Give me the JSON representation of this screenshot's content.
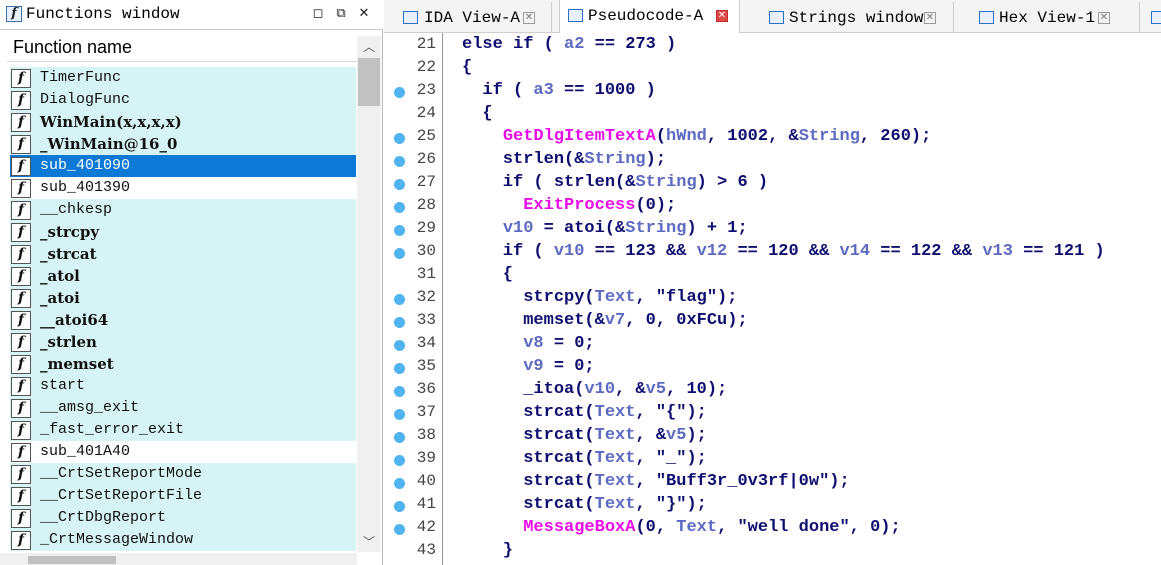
{
  "functions_window": {
    "title": "Functions window",
    "column_header": "Function name",
    "items": [
      {
        "name": "TimerFunc",
        "style": "normal",
        "bg": "cyan"
      },
      {
        "name": "DialogFunc",
        "style": "normal",
        "bg": "cyan"
      },
      {
        "name": "WinMain(x,x,x,x)",
        "style": "bold",
        "bg": "cyan"
      },
      {
        "name": "_WinMain@16_0",
        "style": "bold",
        "bg": "cyan"
      },
      {
        "name": "sub_401090",
        "style": "normal",
        "bg": "selected"
      },
      {
        "name": "sub_401390",
        "style": "normal",
        "bg": "white"
      },
      {
        "name": "__chkesp",
        "style": "normal",
        "bg": "cyan"
      },
      {
        "name": "_strcpy",
        "style": "bold",
        "bg": "cyan"
      },
      {
        "name": "_strcat",
        "style": "bold",
        "bg": "cyan"
      },
      {
        "name": "_atol",
        "style": "bold",
        "bg": "cyan"
      },
      {
        "name": "_atoi",
        "style": "bold",
        "bg": "cyan"
      },
      {
        "name": "__atoi64",
        "style": "bold",
        "bg": "cyan"
      },
      {
        "name": "_strlen",
        "style": "bold",
        "bg": "cyan"
      },
      {
        "name": "_memset",
        "style": "bold",
        "bg": "cyan"
      },
      {
        "name": "start",
        "style": "normal",
        "bg": "cyan"
      },
      {
        "name": "__amsg_exit",
        "style": "normal",
        "bg": "cyan"
      },
      {
        "name": "_fast_error_exit",
        "style": "normal",
        "bg": "cyan"
      },
      {
        "name": "sub_401A40",
        "style": "normal",
        "bg": "white"
      },
      {
        "name": "__CrtSetReportMode",
        "style": "normal",
        "bg": "cyan"
      },
      {
        "name": "__CrtSetReportFile",
        "style": "normal",
        "bg": "cyan"
      },
      {
        "name": "__CrtDbgReport",
        "style": "normal",
        "bg": "cyan"
      },
      {
        "name": "_CrtMessageWindow",
        "style": "normal",
        "bg": "cyan"
      }
    ]
  },
  "tabs": [
    {
      "label": "IDA View-A",
      "active": false
    },
    {
      "label": "Pseudocode-A",
      "active": true
    },
    {
      "label": "Strings window",
      "active": false
    },
    {
      "label": "Hex View-1",
      "active": false
    }
  ],
  "code_lines": [
    {
      "num": "21",
      "dot": false,
      "tokens": [
        [
          "t",
          "else if ( "
        ],
        [
          "v",
          "a2"
        ],
        [
          "t",
          " == 273 )"
        ]
      ]
    },
    {
      "num": "22",
      "dot": false,
      "tokens": [
        [
          "t",
          "{"
        ]
      ]
    },
    {
      "num": "23",
      "dot": true,
      "tokens": [
        [
          "t",
          "  if ( "
        ],
        [
          "v",
          "a3"
        ],
        [
          "t",
          " == 1000 )"
        ]
      ]
    },
    {
      "num": "24",
      "dot": false,
      "tokens": [
        [
          "t",
          "  {"
        ]
      ]
    },
    {
      "num": "25",
      "dot": true,
      "tokens": [
        [
          "t",
          "    "
        ],
        [
          "f",
          "GetDlgItemTextA"
        ],
        [
          "t",
          "("
        ],
        [
          "v",
          "hWnd"
        ],
        [
          "t",
          ", 1002, &"
        ],
        [
          "v",
          "String"
        ],
        [
          "t",
          ", 260);"
        ]
      ]
    },
    {
      "num": "26",
      "dot": true,
      "tokens": [
        [
          "t",
          "    strlen(&"
        ],
        [
          "v",
          "String"
        ],
        [
          "t",
          ");"
        ]
      ]
    },
    {
      "num": "27",
      "dot": true,
      "tokens": [
        [
          "t",
          "    if ( strlen(&"
        ],
        [
          "v",
          "String"
        ],
        [
          "t",
          ") > 6 )"
        ]
      ]
    },
    {
      "num": "28",
      "dot": true,
      "tokens": [
        [
          "t",
          "      "
        ],
        [
          "f",
          "ExitProcess"
        ],
        [
          "t",
          "(0);"
        ]
      ]
    },
    {
      "num": "29",
      "dot": true,
      "tokens": [
        [
          "t",
          "    "
        ],
        [
          "v",
          "v10"
        ],
        [
          "t",
          " = atoi(&"
        ],
        [
          "v",
          "String"
        ],
        [
          "t",
          ") + 1;"
        ]
      ]
    },
    {
      "num": "30",
      "dot": true,
      "tokens": [
        [
          "t",
          "    if ( "
        ],
        [
          "v",
          "v10"
        ],
        [
          "t",
          " == 123 && "
        ],
        [
          "v",
          "v12"
        ],
        [
          "t",
          " == 120 && "
        ],
        [
          "v",
          "v14"
        ],
        [
          "t",
          " == 122 && "
        ],
        [
          "v",
          "v13"
        ],
        [
          "t",
          " == 121 )"
        ]
      ]
    },
    {
      "num": "31",
      "dot": false,
      "tokens": [
        [
          "t",
          "    {"
        ]
      ]
    },
    {
      "num": "32",
      "dot": true,
      "tokens": [
        [
          "t",
          "      strcpy("
        ],
        [
          "v",
          "Text"
        ],
        [
          "t",
          ", \"flag\");"
        ]
      ]
    },
    {
      "num": "33",
      "dot": true,
      "tokens": [
        [
          "t",
          "      memset(&"
        ],
        [
          "v",
          "v7"
        ],
        [
          "t",
          ", 0, 0xFCu);"
        ]
      ]
    },
    {
      "num": "34",
      "dot": true,
      "tokens": [
        [
          "t",
          "      "
        ],
        [
          "v",
          "v8"
        ],
        [
          "t",
          " = 0;"
        ]
      ]
    },
    {
      "num": "35",
      "dot": true,
      "tokens": [
        [
          "t",
          "      "
        ],
        [
          "v",
          "v9"
        ],
        [
          "t",
          " = 0;"
        ]
      ]
    },
    {
      "num": "36",
      "dot": true,
      "tokens": [
        [
          "t",
          "      _itoa("
        ],
        [
          "v",
          "v10"
        ],
        [
          "t",
          ", &"
        ],
        [
          "v",
          "v5"
        ],
        [
          "t",
          ", 10);"
        ]
      ]
    },
    {
      "num": "37",
      "dot": true,
      "tokens": [
        [
          "t",
          "      strcat("
        ],
        [
          "v",
          "Text"
        ],
        [
          "t",
          ", \"{\");"
        ]
      ]
    },
    {
      "num": "38",
      "dot": true,
      "tokens": [
        [
          "t",
          "      strcat("
        ],
        [
          "v",
          "Text"
        ],
        [
          "t",
          ", &"
        ],
        [
          "v",
          "v5"
        ],
        [
          "t",
          ");"
        ]
      ]
    },
    {
      "num": "39",
      "dot": true,
      "tokens": [
        [
          "t",
          "      strcat("
        ],
        [
          "v",
          "Text"
        ],
        [
          "t",
          ", \"_\");"
        ]
      ]
    },
    {
      "num": "40",
      "dot": true,
      "tokens": [
        [
          "t",
          "      strcat("
        ],
        [
          "v",
          "Text"
        ],
        [
          "t",
          ", \"Buff3r_0v3rf|0w\");"
        ]
      ]
    },
    {
      "num": "41",
      "dot": true,
      "tokens": [
        [
          "t",
          "      strcat("
        ],
        [
          "v",
          "Text"
        ],
        [
          "t",
          ", \"}\");"
        ]
      ]
    },
    {
      "num": "42",
      "dot": true,
      "tokens": [
        [
          "t",
          "      "
        ],
        [
          "f",
          "MessageBoxA"
        ],
        [
          "t",
          "(0, "
        ],
        [
          "v",
          "Text"
        ],
        [
          "t",
          ", \"well done\", 0);"
        ]
      ]
    },
    {
      "num": "43",
      "dot": false,
      "tokens": [
        [
          "t",
          "    }"
        ]
      ]
    }
  ],
  "colors": {
    "selection": "#0c79d7",
    "function_row_bg": "#d6f4f5",
    "api_function": "#e80ce8",
    "variable": "#5c6ac2",
    "keyword": "#0e0e70",
    "breakpoint_dot": "#50b4f0"
  },
  "icons": {
    "function": "function-f-icon",
    "tab_close": "close-icon",
    "pane_close": "close-icon",
    "restore": "restore-icon"
  }
}
